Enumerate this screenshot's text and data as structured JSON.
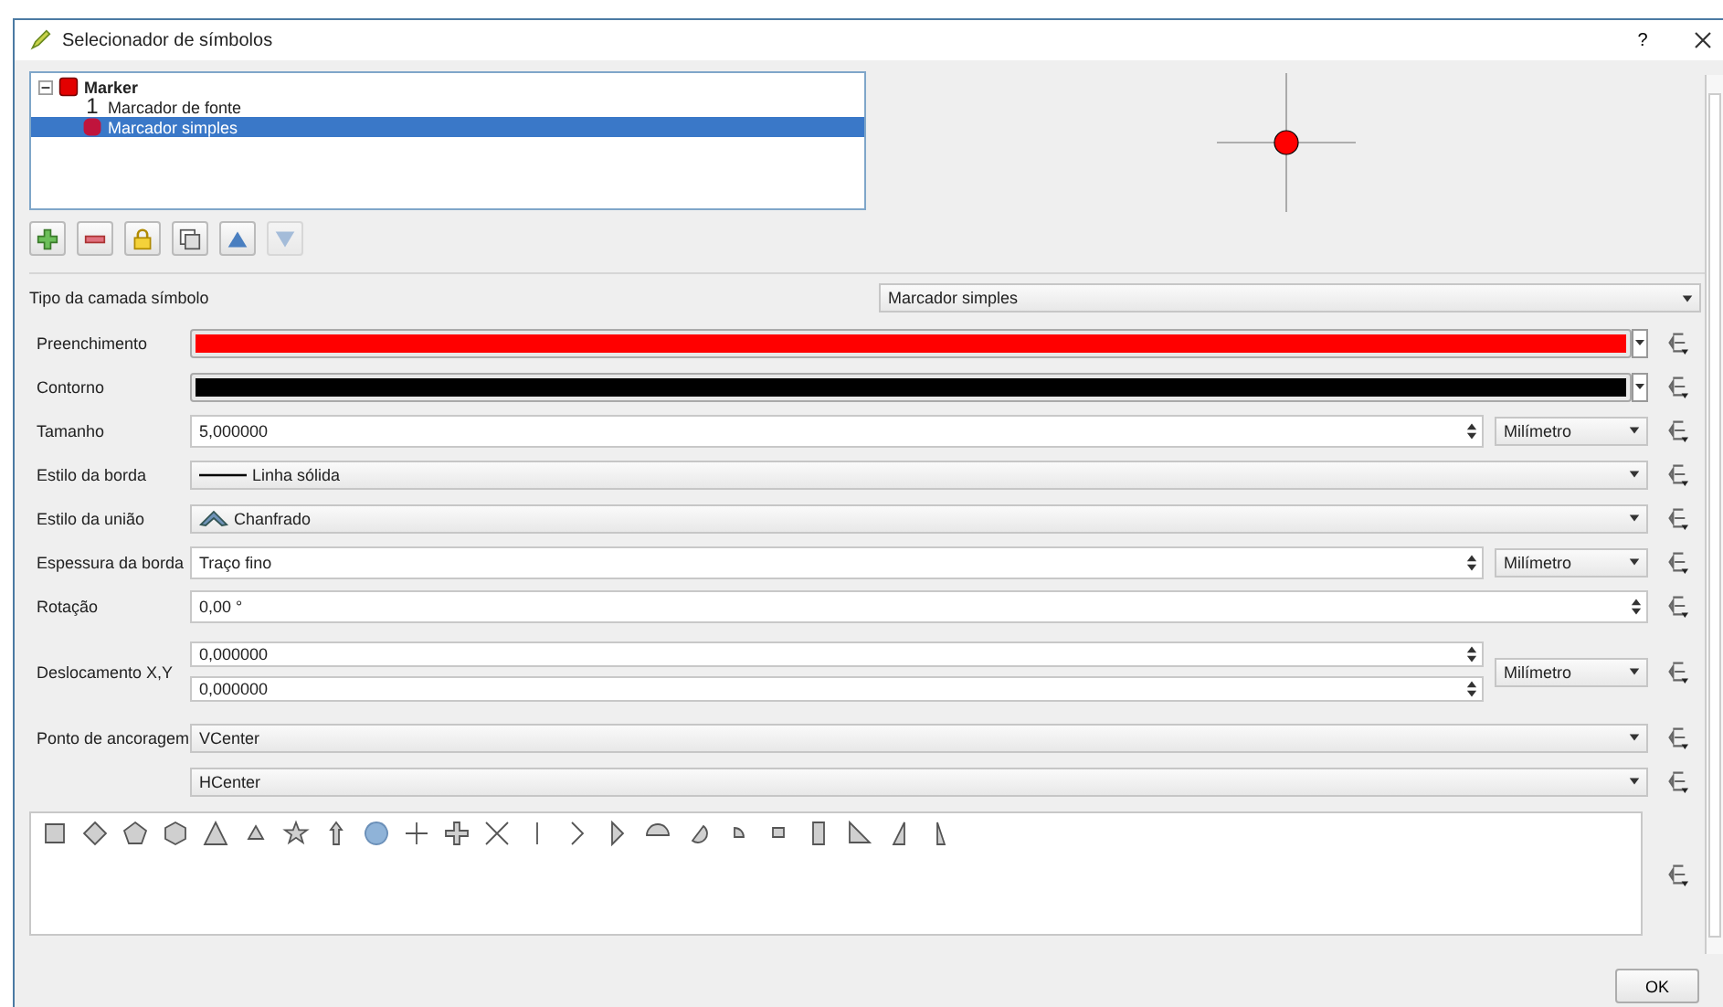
{
  "window": {
    "title": "Selecionador de símbolos",
    "help": "?"
  },
  "tree": [
    {
      "label": "Marker",
      "kind": "marker",
      "expanded": true,
      "selected": false,
      "children": [
        {
          "label": "Marcador de fonte",
          "kind": "font",
          "glyph": "1",
          "selected": false
        },
        {
          "label": "Marcador simples",
          "kind": "simple",
          "selected": true
        }
      ]
    }
  ],
  "toolbar": [
    {
      "kind": "add",
      "disabled": false
    },
    {
      "kind": "remove",
      "disabled": false
    },
    {
      "kind": "lock",
      "disabled": false
    },
    {
      "kind": "duplicate",
      "disabled": false
    },
    {
      "kind": "up",
      "disabled": false
    },
    {
      "kind": "down",
      "disabled": true
    }
  ],
  "layer_type": {
    "label": "Tipo da camada símbolo",
    "value": "Marcador simples"
  },
  "properties": [
    {
      "kind": "color",
      "label": "Preenchimento",
      "color": "#ff0000"
    },
    {
      "kind": "color",
      "label": "Contorno",
      "color": "#000000"
    },
    {
      "kind": "spin",
      "label": "Tamanho",
      "value": "5,000000",
      "unit": "Milímetro"
    },
    {
      "kind": "line_combo",
      "label": "Estilo da borda",
      "value": "Linha sólida"
    },
    {
      "kind": "join_combo",
      "label": "Estilo da união",
      "value": "Chanfrado"
    },
    {
      "kind": "spin",
      "label": "Espessura da borda",
      "value": "Traço fino",
      "unit": "Milímetro"
    },
    {
      "kind": "spin",
      "label": "Rotação",
      "value": "0,00 °"
    },
    {
      "kind": "spin2",
      "label": "Deslocamento X,Y",
      "values": [
        "0,000000",
        "0,000000"
      ],
      "unit": "Milímetro"
    },
    {
      "kind": "combo",
      "label": "Ponto de ancoragem",
      "value": "VCenter"
    },
    {
      "kind": "combo",
      "value": "HCenter"
    }
  ],
  "shapes": [
    {
      "kind": "square",
      "selected": false
    },
    {
      "kind": "diamond",
      "selected": false
    },
    {
      "kind": "pentagon",
      "selected": false
    },
    {
      "kind": "hexagon",
      "selected": false
    },
    {
      "kind": "triangle",
      "selected": false
    },
    {
      "kind": "small_triangle",
      "selected": false
    },
    {
      "kind": "star",
      "selected": false
    },
    {
      "kind": "arrow",
      "selected": false
    },
    {
      "kind": "circle",
      "selected": true
    },
    {
      "kind": "cross",
      "selected": false
    },
    {
      "kind": "cross_fill",
      "selected": false
    },
    {
      "kind": "x",
      "selected": false
    },
    {
      "kind": "line",
      "selected": false
    },
    {
      "kind": "arrowhead",
      "selected": false
    },
    {
      "kind": "filled_arrowhead",
      "selected": false
    },
    {
      "kind": "semi_circle",
      "selected": false
    },
    {
      "kind": "third_circle",
      "selected": false
    },
    {
      "kind": "quarter_circle",
      "selected": false
    },
    {
      "kind": "quarter_square",
      "selected": false
    },
    {
      "kind": "half_square",
      "selected": false
    },
    {
      "kind": "right_half_triangle",
      "selected": false
    },
    {
      "kind": "left_half_triangle",
      "selected": false
    },
    {
      "kind": "thin_half_triangle",
      "selected": false
    }
  ],
  "ok_button": "OK"
}
